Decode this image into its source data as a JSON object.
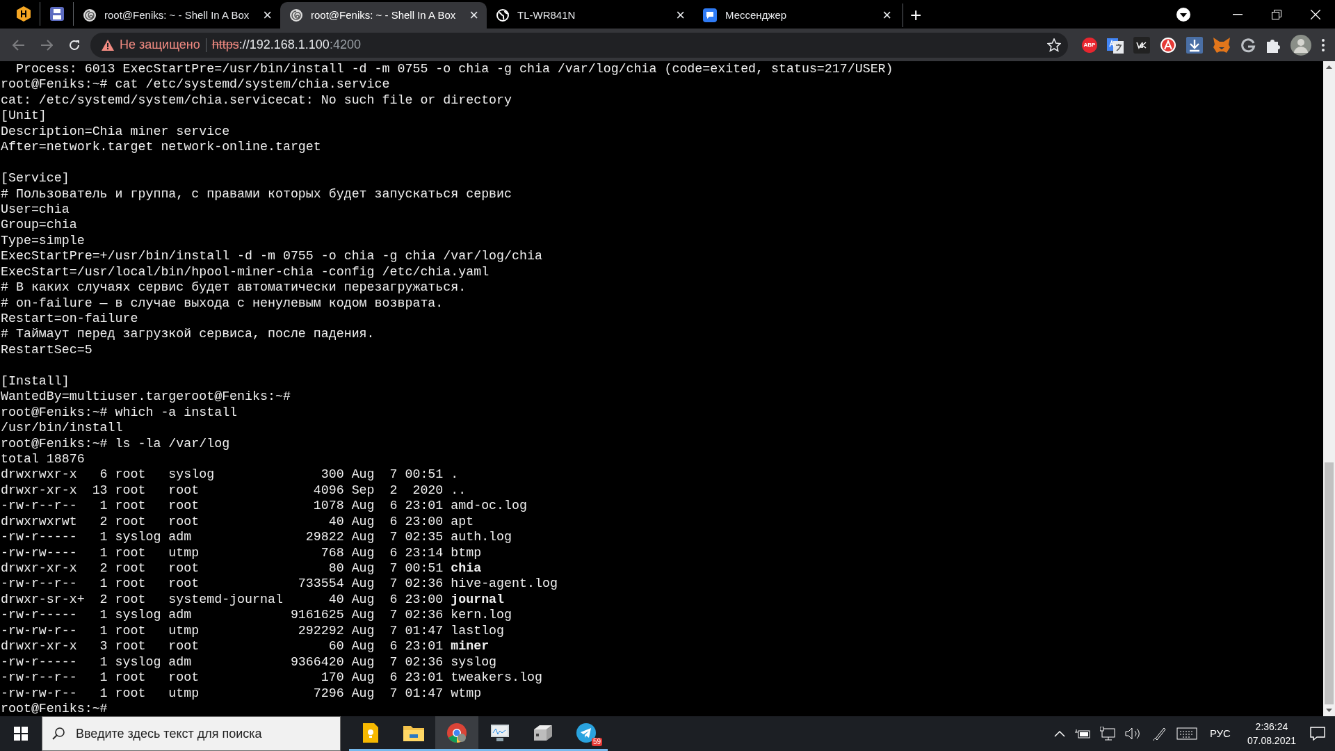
{
  "browser": {
    "tabs": [
      {
        "kind": "pinned",
        "selected": false
      },
      {
        "kind": "pinned",
        "selected": false
      },
      {
        "kind": "tab",
        "title": "root@Feniks: ~ - Shell In A Box",
        "close": "×",
        "selected": false
      },
      {
        "kind": "tab",
        "title": "root@Feniks: ~ - Shell In A Box",
        "close": "×",
        "selected": true
      },
      {
        "kind": "tab",
        "title": "TL-WR841N",
        "close": "×",
        "selected": false
      },
      {
        "kind": "tab",
        "title": "Мессенджер",
        "close": "×",
        "selected": false
      }
    ],
    "new_tab": "+",
    "security_label": "Не защищено",
    "url": {
      "scheme": "https",
      "rest": "://192.168.1.100",
      "port": ":4200"
    },
    "extensions": [
      "ABP"
    ]
  },
  "terminal": {
    "blocks": [
      [
        "  Process: 6013 ExecStartPre=/usr/bin/install -d -m 0755 -o chia -g chia /var/log/chia (code=exited, status=217/USER)",
        "root@Feniks:~# cat /etc/systemd/system/chia.service",
        "cat: /etc/systemd/system/chia.servicecat: No such file or directory",
        "[Unit]",
        "Description=Chia miner service",
        "After=network.target network-online.target"
      ],
      [
        "[Service]",
        "# Пользователь и группа, с правами которых будет запускаться сервис",
        "User=chia",
        "Group=chia",
        "Type=simple",
        "ExecStartPre=+/usr/bin/install -d -m 0755 -o chia -g chia /var/log/chia",
        "ExecStart=/usr/local/bin/hpool-miner-chia -config /etc/chia.yaml",
        "# В каких случаях сервис будет автоматически перезагружаться.",
        "# on-failure — в случае выхода с ненулевым кодом возврата.",
        "Restart=on-failure",
        "# Таймаут перед загрузкой сервиса, после падения.",
        "RestartSec=5"
      ],
      [
        "[Install]",
        "WantedBy=multiuser.targeroot@Feniks:~#",
        "root@Feniks:~# which -a install",
        "/usr/bin/install",
        "root@Feniks:~# ls -la /var/log",
        "total 18876",
        "drwxrwxr-x   6 root   syslog              300 Aug  7 00:51 .",
        "drwxr-xr-x  13 root   root               4096 Sep  2  2020 ..",
        "-rw-r--r--   1 root   root               1078 Aug  6 23:01 amd-oc.log",
        "drwxrwxrwt   2 root   root                 40 Aug  6 23:00 apt",
        "-rw-r-----   1 syslog adm               29822 Aug  7 02:35 auth.log",
        "-rw-rw----   1 root   utmp                768 Aug  6 23:14 btmp",
        "drwxr-xr-x   2 root   root                 80 Aug  7 00:51 **chia**",
        "-rw-r--r--   1 root   root             733554 Aug  7 02:36 hive-agent.log",
        "drwxr-sr-x+  2 root   systemd-journal      40 Aug  6 23:00 **journal**",
        "-rw-r-----   1 syslog adm             9161625 Aug  7 02:36 kern.log",
        "-rw-rw-r--   1 root   utmp             292292 Aug  7 01:47 lastlog",
        "drwxr-xr-x   3 root   root                 60 Aug  6 23:01 **miner**",
        "-rw-r-----   1 syslog adm             9366420 Aug  7 02:36 syslog",
        "-rw-r--r--   1 root   root                170 Aug  6 23:01 tweakers.log",
        "-rw-rw-r--   1 root   utmp               7296 Aug  7 01:47 wtmp",
        "root@Feniks:~#"
      ]
    ]
  },
  "taskbar": {
    "search": {
      "placeholder": "Введите здесь текст для поиска"
    },
    "apps": [
      {
        "selected": false
      },
      {
        "selected": false
      },
      {
        "selected": true
      },
      {
        "selected": false
      },
      {
        "selected": false
      },
      {
        "selected": false,
        "badge": "59"
      }
    ],
    "language": "РУС",
    "time": "2:36:24",
    "date": "07.08.2021"
  }
}
